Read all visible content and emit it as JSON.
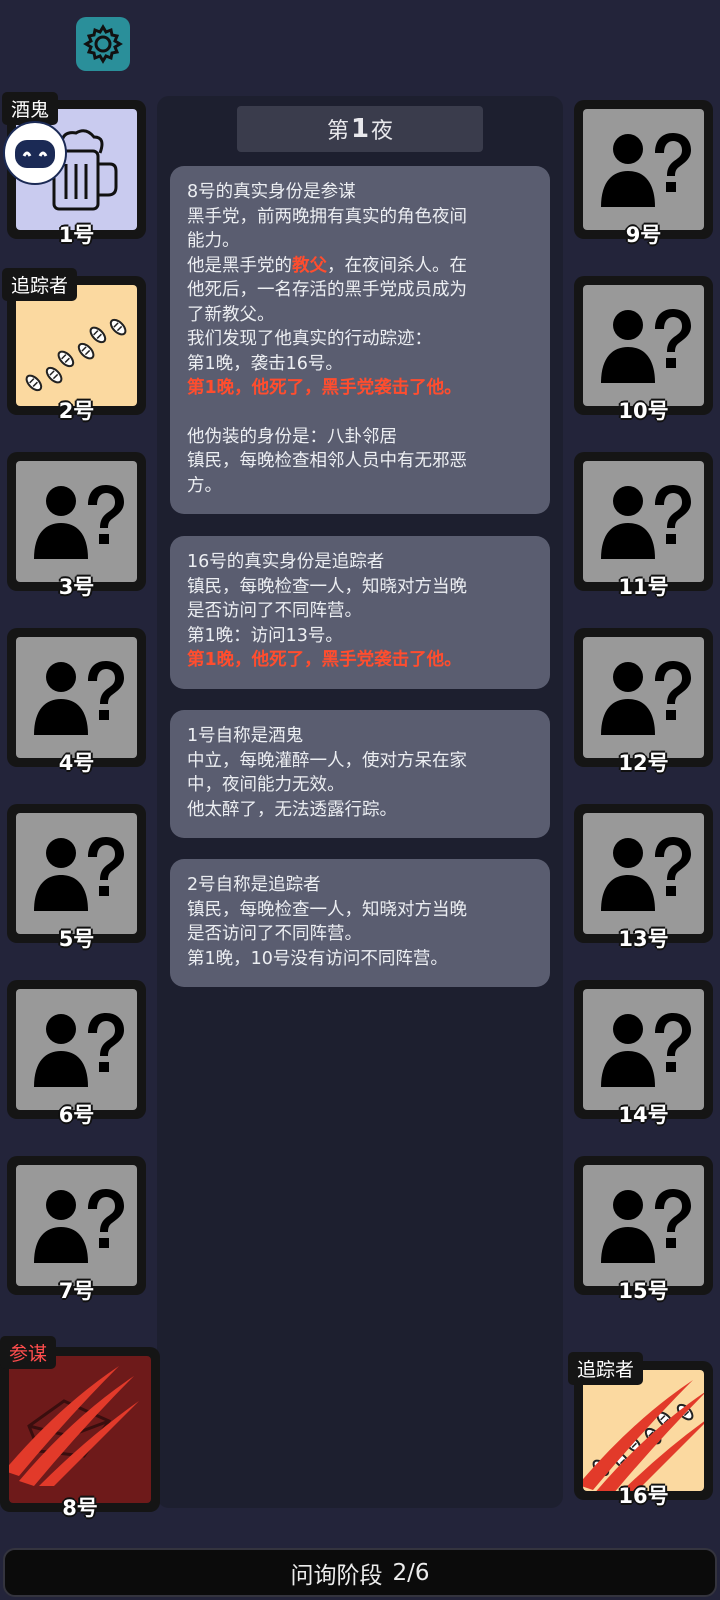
{
  "settings_icon": "gear-icon",
  "night": {
    "prefix": "第",
    "number": "1",
    "suffix": "夜"
  },
  "log_cards": [
    {
      "lines": [
        {
          "text": "8号的真实身份是参谋"
        },
        {
          "text": "黑手党，前两晚拥有真实的角色夜间"
        },
        {
          "text": "能力。"
        },
        {
          "parts": [
            {
              "text": "他是黑手党的"
            },
            {
              "text": "教父",
              "red": true
            },
            {
              "text": "，在夜间杀人。在"
            }
          ]
        },
        {
          "text": "他死后，一名存活的黑手党成员成为"
        },
        {
          "text": "了新教父。"
        },
        {
          "text": "我们发现了他真实的行动踪迹："
        },
        {
          "text": "第1晚，袭击16号。"
        },
        {
          "text": "第1晚，他死了，黑手党袭击了他。",
          "red": true
        },
        {
          "gap": true
        },
        {
          "text": "他伪装的身份是：八卦邻居"
        },
        {
          "text": "镇民，每晚检查相邻人员中有无邪恶"
        },
        {
          "text": "方。"
        }
      ]
    },
    {
      "lines": [
        {
          "text": "16号的真实身份是追踪者"
        },
        {
          "text": "镇民，每晚检查一人，知晓对方当晚"
        },
        {
          "text": "是否访问了不同阵营。"
        },
        {
          "text": "第1晚：访问13号。"
        },
        {
          "text": "第1晚，他死了，黑手党袭击了他。",
          "red": true
        }
      ]
    },
    {
      "lines": [
        {
          "text": "1号自称是酒鬼"
        },
        {
          "text": "中立，每晚灌醉一人，使对方呆在家"
        },
        {
          "text": "中，夜间能力无效。"
        },
        {
          "text": "他太醉了，无法透露行踪。"
        }
      ]
    },
    {
      "lines": [
        {
          "text": "2号自称是追踪者"
        },
        {
          "text": "镇民，每晚检查一人，知晓对方当晚"
        },
        {
          "text": "是否访问了不同阵营。"
        },
        {
          "text": "第1晚，10号没有访问不同阵营。"
        }
      ]
    }
  ],
  "players": [
    {
      "label": "1号",
      "role_tag": "酒鬼",
      "icon": "beer-mug-icon",
      "revealed": true
    },
    {
      "label": "2号",
      "role_tag": "追踪者",
      "icon": "footprints-icon",
      "revealed": true
    },
    {
      "label": "3号",
      "icon": "unknown-player-icon"
    },
    {
      "label": "4号",
      "icon": "unknown-player-icon"
    },
    {
      "label": "5号",
      "icon": "unknown-player-icon"
    },
    {
      "label": "6号",
      "icon": "unknown-player-icon"
    },
    {
      "label": "7号",
      "icon": "unknown-player-icon"
    },
    {
      "label": "8号",
      "role_tag": "参谋",
      "icon": "claw-slash-icon",
      "dead": true
    },
    {
      "label": "9号",
      "icon": "unknown-player-icon"
    },
    {
      "label": "10号",
      "icon": "unknown-player-icon"
    },
    {
      "label": "11号",
      "icon": "unknown-player-icon"
    },
    {
      "label": "12号",
      "icon": "unknown-player-icon"
    },
    {
      "label": "13号",
      "icon": "unknown-player-icon"
    },
    {
      "label": "14号",
      "icon": "unknown-player-icon"
    },
    {
      "label": "15号",
      "icon": "unknown-player-icon"
    },
    {
      "label": "16号",
      "role_tag": "追踪者",
      "icon": "footprints-icon",
      "dead": true
    }
  ],
  "colors": {
    "background": "#23243a",
    "panel": "#1d1f2f",
    "card": "#5a5d70",
    "highlight_red": "#ff4d2e",
    "unknown_tile": "#999999",
    "drunk_tile": "#c9cbef",
    "tracker_tile": "#fbd9a0",
    "dead_tile": "#6e1a1a",
    "gear_button": "#2a8f9a"
  },
  "phase": {
    "label": "问询阶段",
    "progress": "2/6"
  }
}
